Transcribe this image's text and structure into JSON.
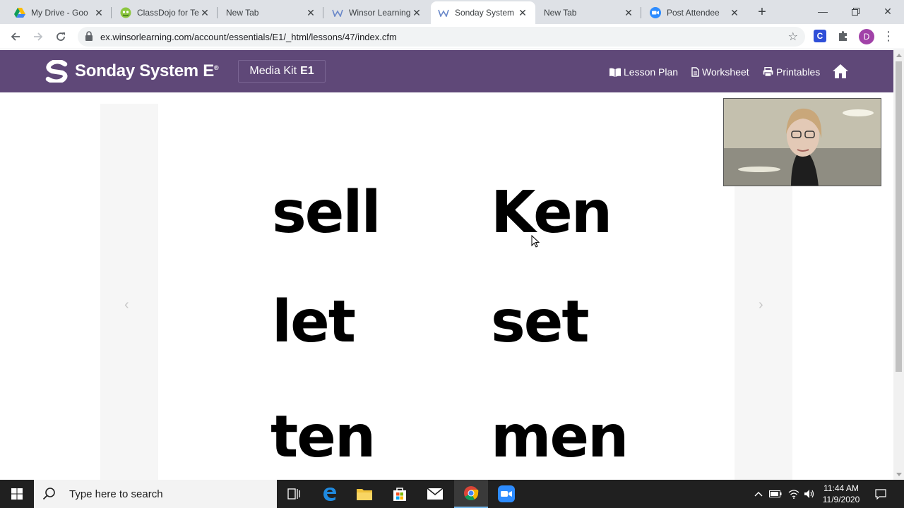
{
  "browser": {
    "tabs": [
      {
        "title": "My Drive - Goo",
        "icon": "google-drive-icon"
      },
      {
        "title": "ClassDojo for Te",
        "icon": "classdojo-icon"
      },
      {
        "title": "New Tab",
        "icon": ""
      },
      {
        "title": "Winsor Learning",
        "icon": "winsor-icon"
      },
      {
        "title": "Sonday System",
        "icon": "winsor-icon",
        "active": true
      },
      {
        "title": "New Tab",
        "icon": ""
      },
      {
        "title": "Post Attendee",
        "icon": "zoom-icon"
      }
    ],
    "url": "ex.winsorlearning.com/account/essentials/E1/_html/lessons/47/index.cfm",
    "profile_initial": "D",
    "extension_label": "C"
  },
  "site": {
    "brand": "Sonday System",
    "brand_suffix": "E",
    "brand_reg": "®",
    "media_kit": "Media Kit",
    "media_kit_level": "E1",
    "nav": {
      "lesson_plan": "Lesson Plan",
      "worksheet": "Worksheet",
      "printables": "Printables"
    },
    "colors": {
      "header_bg": "#5f4878"
    }
  },
  "words": [
    "sell",
    "Ken",
    "let",
    "set",
    "ten",
    "men"
  ],
  "arrows": {
    "prev": "‹",
    "next": "›"
  },
  "taskbar": {
    "search_placeholder": "Type here to search",
    "time": "11:44 AM",
    "date": "11/9/2020"
  }
}
